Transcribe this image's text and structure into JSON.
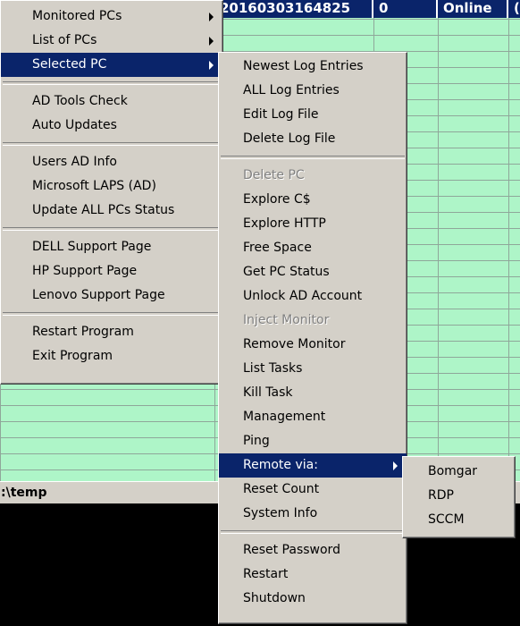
{
  "grid": {
    "header_cells": [
      "20160303164825",
      "0",
      "Online",
      "("
    ]
  },
  "status_bar": {
    "path": ":\\temp"
  },
  "main_menu": {
    "groups": [
      [
        {
          "label": "Monitored PCs",
          "submenu": true
        },
        {
          "label": "List of PCs",
          "submenu": true
        },
        {
          "label": "Selected PC",
          "submenu": true,
          "selected": true
        }
      ],
      [
        {
          "label": "AD Tools Check"
        },
        {
          "label": "Auto Updates"
        }
      ],
      [
        {
          "label": "Users AD Info"
        },
        {
          "label": "Microsoft LAPS (AD)"
        },
        {
          "label": "Update ALL PCs Status"
        }
      ],
      [
        {
          "label": "DELL Support Page"
        },
        {
          "label": "HP Support Page"
        },
        {
          "label": "Lenovo Support Page"
        }
      ],
      [
        {
          "label": "Restart Program"
        },
        {
          "label": "Exit Program"
        }
      ]
    ]
  },
  "selected_pc_menu": {
    "groups": [
      [
        {
          "label": "Newest Log Entries"
        },
        {
          "label": "ALL Log Entries"
        },
        {
          "label": "Edit Log File"
        },
        {
          "label": "Delete Log File"
        }
      ],
      [
        {
          "label": "Delete PC",
          "disabled": true
        },
        {
          "label": "Explore C$"
        },
        {
          "label": "Explore HTTP"
        },
        {
          "label": "Free Space"
        },
        {
          "label": "Get PC Status"
        },
        {
          "label": "Unlock AD Account"
        },
        {
          "label": "Inject Monitor",
          "disabled": true
        },
        {
          "label": "Remove Monitor"
        },
        {
          "label": "List Tasks"
        },
        {
          "label": "Kill Task"
        },
        {
          "label": "Management"
        },
        {
          "label": "Ping"
        },
        {
          "label": "Remote via:",
          "submenu": true,
          "selected": true
        },
        {
          "label": "Reset Count"
        },
        {
          "label": "System Info"
        }
      ],
      [
        {
          "label": "Reset Password"
        },
        {
          "label": "Restart"
        },
        {
          "label": "Shutdown"
        }
      ]
    ]
  },
  "remote_menu": {
    "items": [
      {
        "label": "Bomgar"
      },
      {
        "label": "RDP"
      },
      {
        "label": "SCCM"
      }
    ]
  },
  "colors": {
    "grid_bg": "#aef5c8",
    "menu_bg": "#d4d0c8",
    "highlight": "#0a246a"
  }
}
